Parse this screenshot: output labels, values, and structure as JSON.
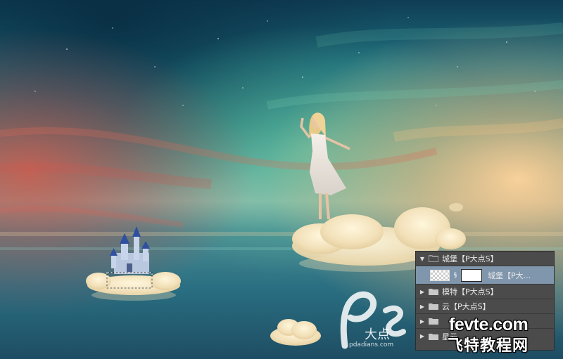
{
  "layers_panel": {
    "rows": [
      {
        "name": "城堡【P大点S】",
        "type": "group",
        "expanded": true
      },
      {
        "name": "城堡【P大...",
        "type": "layer-with-mask",
        "selected": true
      },
      {
        "name": "模特【P大点S】",
        "type": "group",
        "expanded": false
      },
      {
        "name": "云【P大点S】",
        "type": "group",
        "expanded": false
      },
      {
        "name": "",
        "type": "group",
        "expanded": false
      },
      {
        "name": "星云",
        "type": "group",
        "expanded": false
      }
    ]
  },
  "watermarks": {
    "ps_logo_text": "大点",
    "ps_site": "pdadians.com",
    "fevte_domain": "fevte.com",
    "fevte_cn": "飞特教程网"
  },
  "colors": {
    "panel_bg": "#4b4b4b",
    "panel_selected": "#7f96ad",
    "sky_teal": "#2f8f88",
    "sunset_red": "#c9564a",
    "horizon_glow": "#f4c987"
  },
  "icons": [
    "folder-icon",
    "expand-arrow-icon",
    "collapse-arrow-icon",
    "chain-link-icon",
    "selection-marquee"
  ]
}
